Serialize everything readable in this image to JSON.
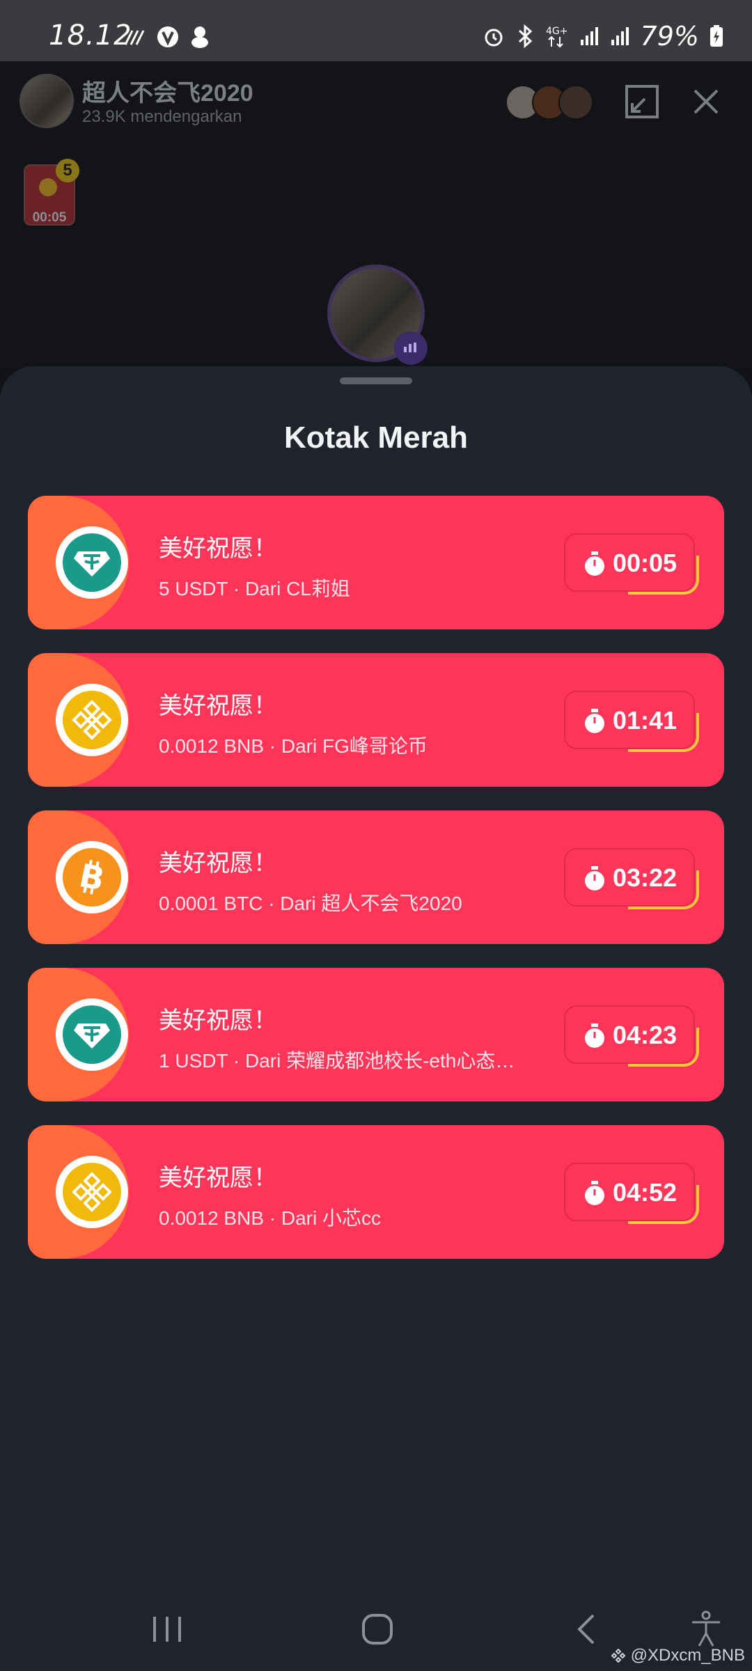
{
  "status_bar": {
    "time": "18.12",
    "network": "4G+",
    "battery": "79%"
  },
  "room": {
    "host_name": "超人不会飞2020",
    "listeners": "23.9K mendengarkan",
    "red_box_count": "5",
    "red_box_timer": "00:05"
  },
  "sheet": {
    "title": "Kotak Merah",
    "items": [
      {
        "coin": "usdt-icon",
        "title": "美好祝愿！",
        "subtitle": "5 USDT · Dari CL莉姐",
        "timer": "00:05"
      },
      {
        "coin": "bnb-icon",
        "title": "美好祝愿！",
        "subtitle": "0.0012 BNB · Dari FG峰哥论币",
        "timer": "01:41"
      },
      {
        "coin": "btc-icon",
        "title": "美好祝愿！",
        "subtitle": "0.0001 BTC · Dari 超人不会飞2020",
        "timer": "03:22"
      },
      {
        "coin": "usdt-icon",
        "title": "美好祝愿！",
        "subtitle": "1 USDT · Dari 荣耀成都池校长-eth心态…",
        "timer": "04:23"
      },
      {
        "coin": "bnb-icon",
        "title": "美好祝愿！",
        "subtitle": "0.0012 BNB · Dari 小芯cc",
        "timer": "04:52"
      }
    ]
  },
  "watermark": "@XDxcm_BNB",
  "colors": {
    "card": "#fe3558",
    "card_tab": "#ff6a3d",
    "usdt": "#1a9a8a",
    "bnb": "#f0b90b",
    "btc": "#f7931a",
    "timer_arc": "#ffc93e"
  }
}
